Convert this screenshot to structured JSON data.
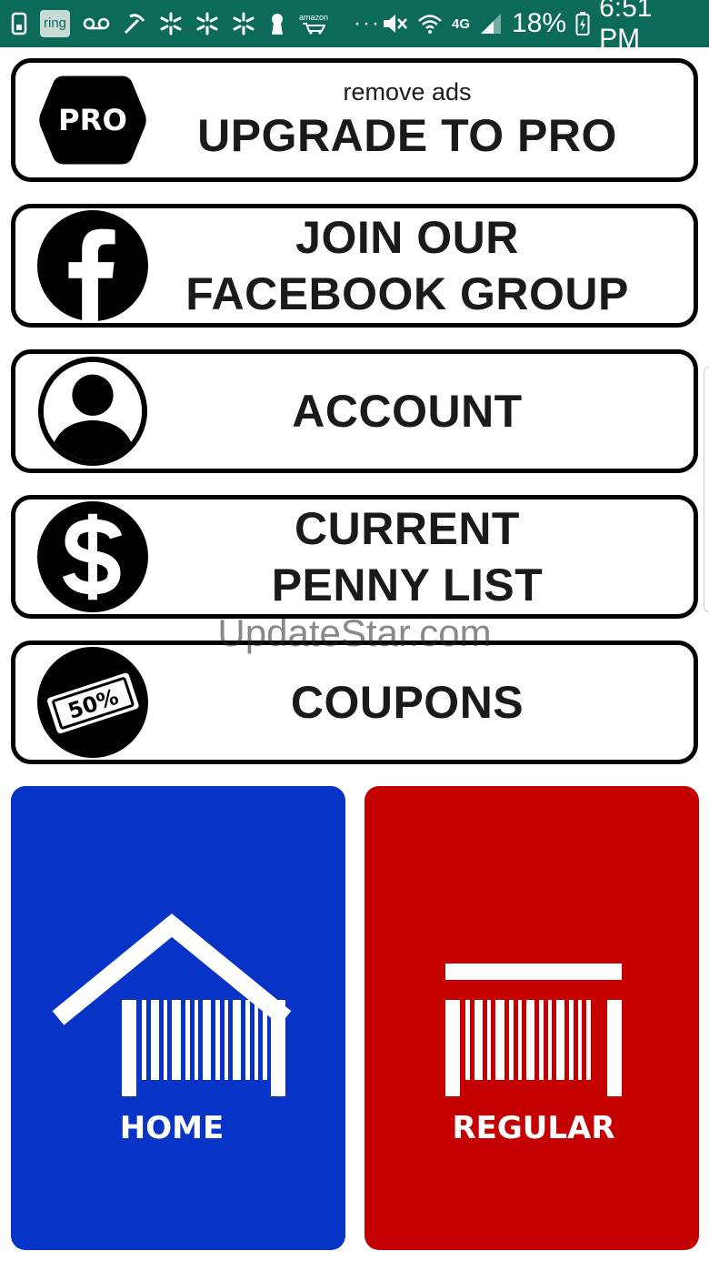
{
  "status_bar": {
    "ring_label": "ring",
    "amazon_label": "amazon",
    "more": "···",
    "network": "4G",
    "battery": "18%",
    "time": "6:51 PM"
  },
  "menu": {
    "pro": {
      "icon_text": "PRO",
      "subtitle": "remove ads",
      "title": "UPGRADE TO PRO"
    },
    "facebook": {
      "line1": "JOIN OUR",
      "line2": "FACEBOOK GROUP"
    },
    "account": {
      "title": "ACCOUNT"
    },
    "penny": {
      "line1": "CURRENT",
      "line2": "PENNY LIST"
    },
    "coupons": {
      "icon_text": "50%",
      "title": "COUPONS"
    }
  },
  "watermark": "UpdateStar.com",
  "tiles": {
    "home": {
      "label": "HOME",
      "color": "#0733c7"
    },
    "regular": {
      "label": "REGULAR",
      "color": "#c40000"
    }
  }
}
